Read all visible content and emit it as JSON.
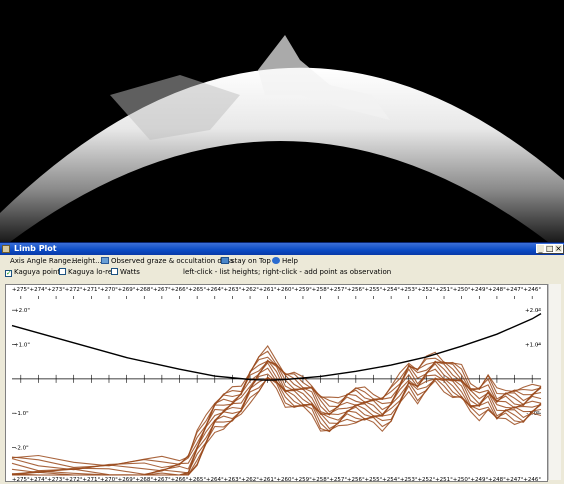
{
  "window": {
    "title": "Limb Plot",
    "buttons": {
      "minimize": "_",
      "maximize": "□",
      "close": "×"
    }
  },
  "menu": {
    "axis_angle": "Axis Angle Range...",
    "height": "Height...",
    "observed": "Observed graze & occultation data",
    "stay_on_top": "stay on Top",
    "help": "Help"
  },
  "options": {
    "kaguya_points": {
      "label": "Kaguya points",
      "checked": true
    },
    "kaguya_lores": {
      "label": "Kaguya lo-res",
      "checked": false
    },
    "watts": {
      "label": "Watts",
      "checked": false
    },
    "hint": "left-click - list heights;   right-click - add point as observation"
  },
  "chart_data": {
    "type": "line",
    "x_ticks": [
      "+275°",
      "+274°",
      "+273°",
      "+272°",
      "+271°",
      "+270°",
      "+269°",
      "+268°",
      "+267°",
      "+266°",
      "+265°",
      "+264°",
      "+263°",
      "+262°",
      "+261°",
      "+260°",
      "+259°",
      "+258°",
      "+257°",
      "+256°",
      "+255°",
      "+254°",
      "+253°",
      "+252°",
      "+251°",
      "+250°",
      "+249°",
      "+248°",
      "+247°",
      "+246°"
    ],
    "y_ticks_left": [
      "+2.0\"",
      "+1.0\"",
      "-1.0\"",
      "-2.0\""
    ],
    "y_ticks_right": [
      "+2.0\"",
      "+1.0\"",
      "-1.0\""
    ],
    "xlim": [
      275.5,
      245.5
    ],
    "ylim": [
      -2.8,
      2.5
    ],
    "colors": {
      "curve": "#000000",
      "profile": "#9a4a1c"
    },
    "reference_curve": {
      "x": [
        275.5,
        272,
        269,
        266,
        264,
        262,
        261,
        260,
        258,
        256,
        254,
        252,
        250,
        248,
        246,
        245.5
      ],
      "y": [
        1.55,
        1.05,
        0.62,
        0.28,
        0.08,
        -0.02,
        -0.04,
        -0.02,
        0.07,
        0.22,
        0.4,
        0.64,
        0.95,
        1.3,
        1.75,
        1.9
      ]
    },
    "limb_profile": {
      "x": [
        275.5,
        274,
        272,
        270,
        268,
        267,
        266,
        265.5,
        265,
        264.5,
        264,
        263.5,
        263,
        262.5,
        262,
        261.5,
        261,
        260.5,
        260,
        259.5,
        259,
        258.5,
        258,
        257.5,
        257,
        256.5,
        256,
        255.5,
        255,
        254.5,
        254,
        253.5,
        253,
        252.5,
        252,
        251.5,
        251,
        250.5,
        250,
        249.5,
        249,
        248.5,
        248,
        247.5,
        247,
        246.5,
        246,
        245.5
      ],
      "y": [
        -2.3,
        -2.35,
        -2.4,
        -2.42,
        -2.4,
        -2.35,
        -2.3,
        -2.2,
        -1.6,
        -1.1,
        -0.6,
        -0.45,
        -0.35,
        -0.2,
        0.3,
        0.6,
        0.85,
        0.6,
        0.2,
        0.1,
        0.0,
        -0.1,
        -0.5,
        -0.65,
        -0.55,
        -0.35,
        -0.3,
        -0.35,
        -0.4,
        -0.5,
        -0.3,
        0.1,
        0.55,
        0.3,
        0.55,
        0.75,
        0.6,
        0.45,
        0.3,
        -0.1,
        -0.2,
        0.05,
        -0.35,
        -0.25,
        -0.3,
        -0.35,
        -0.2,
        -0.1
      ]
    }
  }
}
